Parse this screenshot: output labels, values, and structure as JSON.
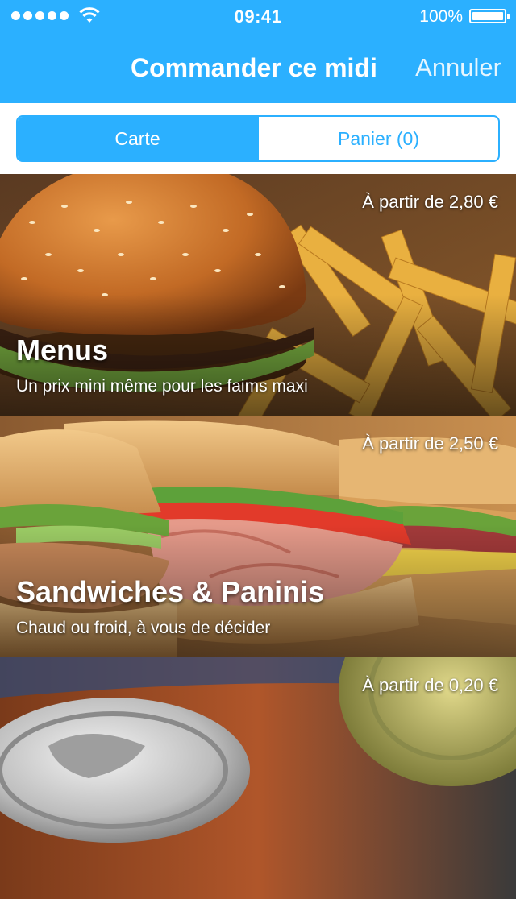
{
  "status_bar": {
    "time": "09:41",
    "battery": "100%"
  },
  "nav": {
    "title": "Commander ce midi",
    "cancel": "Annuler"
  },
  "segments": {
    "carte": "Carte",
    "panier": "Panier (0)",
    "selected": "carte"
  },
  "categories": [
    {
      "title": "Menus",
      "subtitle": "Un prix mini même pour les faims maxi",
      "price": "À partir de 2,80 €",
      "image": "burger-fries-photo"
    },
    {
      "title": "Sandwiches & Paninis",
      "subtitle": "Chaud ou froid, à vous de décider",
      "price": "À partir de 2,50 €",
      "image": "sandwiches-photo"
    },
    {
      "title": "",
      "subtitle": "",
      "price": "À partir de 0,20 €",
      "image": "drink-cans-photo"
    }
  ],
  "colors": {
    "accent": "#2bb0ff",
    "white": "#ffffff"
  }
}
